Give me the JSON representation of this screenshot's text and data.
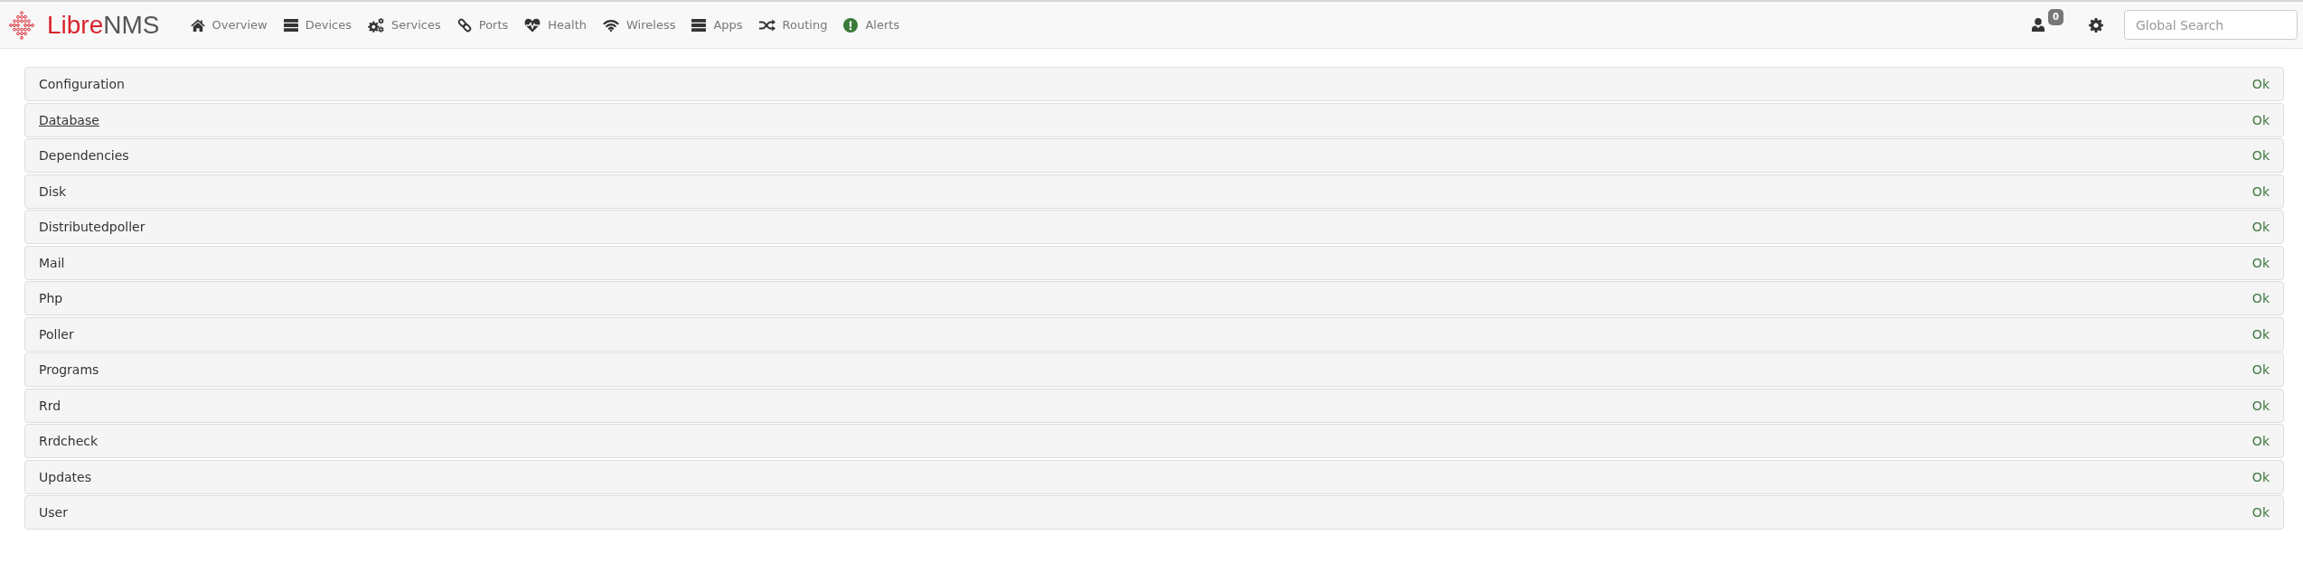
{
  "navbar": {
    "logo": {
      "part_1": "Libre",
      "part_2": "NMS"
    },
    "menu": [
      {
        "label": "Overview"
      },
      {
        "label": "Devices"
      },
      {
        "label": "Services"
      },
      {
        "label": "Ports"
      },
      {
        "label": "Health"
      },
      {
        "label": "Wireless"
      },
      {
        "label": "Apps"
      },
      {
        "label": "Routing"
      },
      {
        "label": "Alerts"
      }
    ],
    "notifications": {
      "count": "0"
    },
    "search": {
      "placeholder": "Global Search"
    }
  },
  "checks": [
    {
      "name": "Configuration",
      "status": "Ok",
      "hovered": false
    },
    {
      "name": "Database",
      "status": "Ok",
      "hovered": true
    },
    {
      "name": "Dependencies",
      "status": "Ok",
      "hovered": false
    },
    {
      "name": "Disk",
      "status": "Ok",
      "hovered": false
    },
    {
      "name": "Distributedpoller",
      "status": "Ok",
      "hovered": false
    },
    {
      "name": "Mail",
      "status": "Ok",
      "hovered": false
    },
    {
      "name": "Php",
      "status": "Ok",
      "hovered": false
    },
    {
      "name": "Poller",
      "status": "Ok",
      "hovered": false
    },
    {
      "name": "Programs",
      "status": "Ok",
      "hovered": false
    },
    {
      "name": "Rrd",
      "status": "Ok",
      "hovered": false
    },
    {
      "name": "Rrdcheck",
      "status": "Ok",
      "hovered": false
    },
    {
      "name": "Updates",
      "status": "Ok",
      "hovered": false
    },
    {
      "name": "User",
      "status": "Ok",
      "hovered": false
    }
  ]
}
